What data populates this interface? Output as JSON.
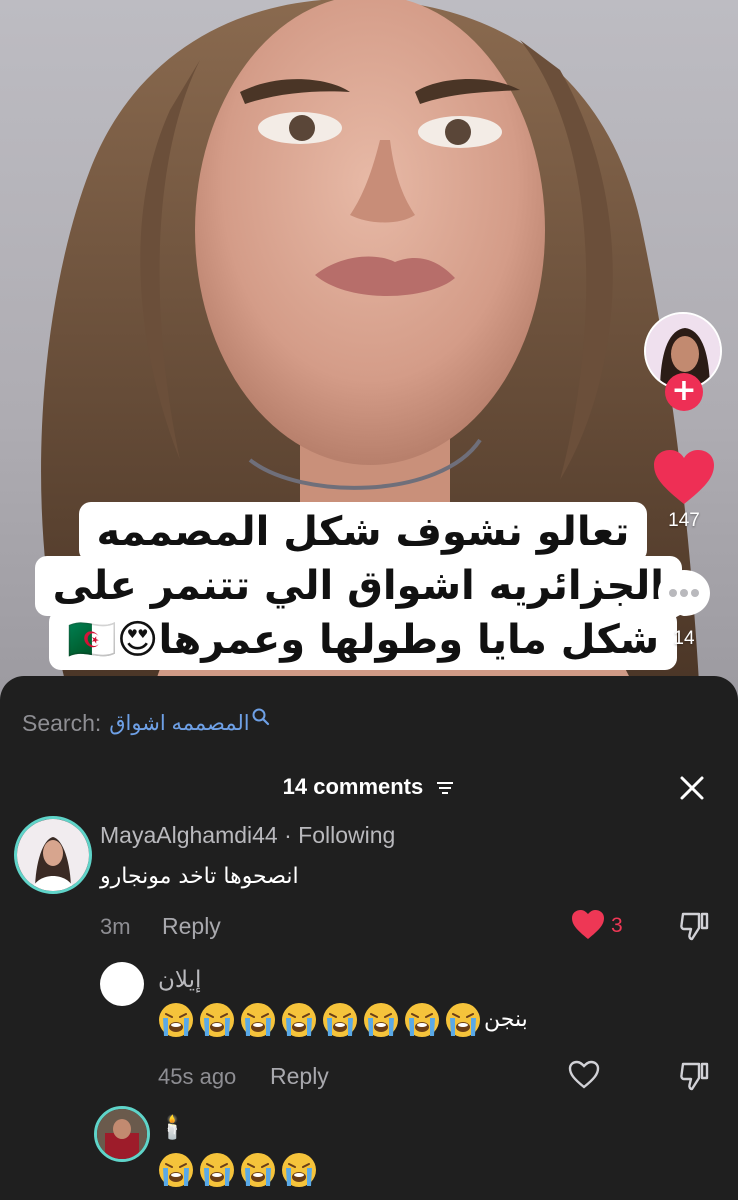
{
  "video": {
    "caption_lines": [
      "تعالو نشوف شكل المصممه",
      "الجزائريه اشواق الي تتنمر على",
      "شكل مايا وطولها وعمرها😍🇩🇿"
    ],
    "likes": "147",
    "comments": "14"
  },
  "sheet": {
    "search_prefix": "Search:",
    "search_term": "المصممه اشواق",
    "comments_title": "14 comments"
  },
  "comments": [
    {
      "user": "MayaAlghamdi44 · Following",
      "text": "انصحوها تاخد مونجارو",
      "time": "3m",
      "reply_label": "Reply",
      "likes": "3",
      "liked": true
    },
    {
      "user": "إيلان",
      "text": "بنجن",
      "emoji_count": 8,
      "time": "45s ago",
      "reply_label": "Reply"
    },
    {
      "user": "🕯️",
      "emoji_count": 4
    }
  ],
  "colors": {
    "accent_red": "#ee2f55",
    "link_blue": "#6ea0e6",
    "sheet_bg": "#1f1f1f",
    "muted_text": "#8e8e93"
  },
  "icons": [
    "plus-icon",
    "heart-icon",
    "comment-bubble-icon",
    "search-icon",
    "filter-icon",
    "close-icon",
    "dislike-icon",
    "loudly-crying-emoji"
  ]
}
